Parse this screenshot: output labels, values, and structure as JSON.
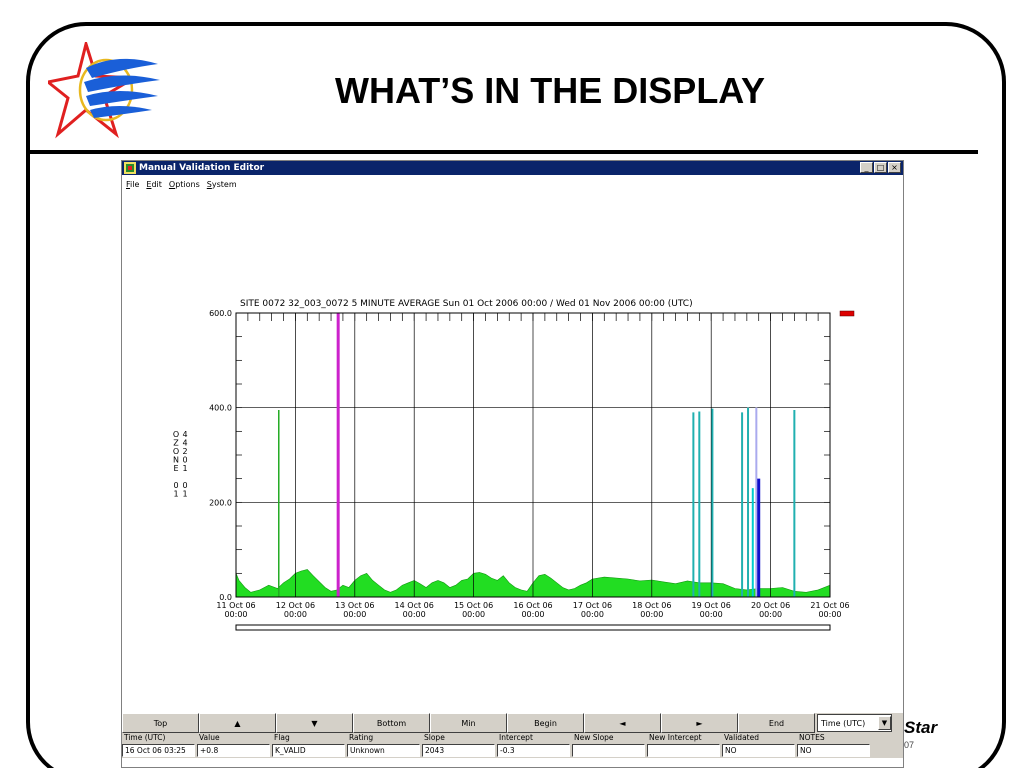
{
  "slide": {
    "title": "WHAT’S IN THE DISPLAY",
    "footer_text": "Star",
    "footer_number": "07"
  },
  "window": {
    "title": "Manual Validation Editor",
    "menu": [
      "File",
      "Edit",
      "Options",
      "System"
    ],
    "controls": [
      "minimize-icon",
      "maximize-icon",
      "close-icon"
    ]
  },
  "chart_data": {
    "type": "area",
    "title": "SITE 0072 32_003_0072 5 MINUTE AVERAGE Sun 01 Oct 2006 00:00 / Wed 01 Nov 2006 00:00 (UTC)",
    "ylabel_chars": [
      "O",
      "Z",
      "O",
      "N",
      "E",
      "",
      "0",
      "1"
    ],
    "ylabel_code": [
      "4",
      "4",
      "2",
      "0",
      "1",
      "",
      "0",
      "1"
    ],
    "ylim": [
      0,
      600
    ],
    "yticks": [
      {
        "value": 0,
        "label": "0.0"
      },
      {
        "value": 200,
        "label": "200.0"
      },
      {
        "value": 400,
        "label": "400.0"
      },
      {
        "value": 600,
        "label": "600.0"
      }
    ],
    "xlim": [
      "2006-10-11 00:00",
      "2006-10-21 00:00"
    ],
    "xticks": [
      {
        "day": 0,
        "date": "11 Oct 06",
        "time": "00:00"
      },
      {
        "day": 1,
        "date": "12 Oct 06",
        "time": "00:00"
      },
      {
        "day": 2,
        "date": "13 Oct 06",
        "time": "00:00"
      },
      {
        "day": 3,
        "date": "14 Oct 06",
        "time": "00:00"
      },
      {
        "day": 4,
        "date": "15 Oct 06",
        "time": "00:00"
      },
      {
        "day": 5,
        "date": "16 Oct 06",
        "time": "00:00"
      },
      {
        "day": 6,
        "date": "17 Oct 06",
        "time": "00:00"
      },
      {
        "day": 7,
        "date": "18 Oct 06",
        "time": "00:00"
      },
      {
        "day": 8,
        "date": "19 Oct 06",
        "time": "00:00"
      },
      {
        "day": 9,
        "date": "20 Oct 06",
        "time": "00:00"
      },
      {
        "day": 10,
        "date": "21 Oct 06",
        "time": "00:00"
      }
    ],
    "grid": true,
    "series": [
      {
        "color": "#22dd22",
        "x": [
          0,
          0.05,
          0.15,
          0.25,
          0.4,
          0.55,
          0.7,
          0.8,
          0.9,
          1.0,
          1.1,
          1.2,
          1.3,
          1.5,
          1.6,
          1.7,
          1.8,
          1.9,
          2.0,
          2.1,
          2.2,
          2.3,
          2.4,
          2.5,
          2.6,
          2.7,
          2.8,
          2.9,
          3.0,
          3.1,
          3.2,
          3.3,
          3.4,
          3.5,
          3.6,
          3.7,
          3.8,
          3.9,
          4.0,
          4.1,
          4.2,
          4.3,
          4.4,
          4.5,
          4.6,
          4.7,
          4.8,
          4.9,
          5.0,
          5.1,
          5.2,
          5.3,
          5.4,
          5.5,
          5.6,
          5.7,
          5.8,
          5.9,
          6.0,
          6.2,
          6.4,
          6.6,
          6.8,
          7.0,
          7.2,
          7.4,
          7.6,
          7.8,
          8.0,
          8.2,
          8.4,
          8.6,
          8.8,
          9.0,
          9.2,
          9.4,
          9.6,
          9.8,
          10.0
        ],
        "y": [
          50,
          35,
          20,
          10,
          15,
          25,
          18,
          30,
          38,
          50,
          55,
          58,
          45,
          20,
          12,
          15,
          25,
          20,
          35,
          45,
          50,
          35,
          25,
          15,
          10,
          15,
          25,
          30,
          35,
          28,
          20,
          30,
          35,
          30,
          20,
          25,
          35,
          38,
          50,
          52,
          48,
          40,
          35,
          45,
          30,
          20,
          15,
          12,
          30,
          45,
          48,
          40,
          30,
          20,
          15,
          18,
          25,
          30,
          38,
          42,
          40,
          38,
          34,
          36,
          32,
          28,
          34,
          30,
          30,
          28,
          18,
          15,
          18,
          18,
          20,
          12,
          10,
          15,
          25
        ]
      }
    ],
    "spikes": [
      {
        "x": 0.72,
        "y": 395,
        "color": "#22aa22",
        "width": 1.5
      },
      {
        "x": 1.72,
        "y": 600,
        "color": "#cc22cc",
        "width": 3
      },
      {
        "x": 7.7,
        "y": 390,
        "color": "#20b0b0",
        "width": 2
      },
      {
        "x": 7.8,
        "y": 392,
        "color": "#20b0b0",
        "width": 2
      },
      {
        "x": 8.02,
        "y": 398,
        "color": "#20b0b0",
        "width": 2
      },
      {
        "x": 8.52,
        "y": 390,
        "color": "#20b0b0",
        "width": 2
      },
      {
        "x": 8.62,
        "y": 400,
        "color": "#20b0b0",
        "width": 2
      },
      {
        "x": 8.7,
        "y": 230,
        "color": "#00cccc",
        "width": 2
      },
      {
        "x": 8.76,
        "y": 400,
        "color": "#aaaaee",
        "width": 2
      },
      {
        "x": 8.8,
        "y": 250,
        "color": "#1010cc",
        "width": 3
      },
      {
        "x": 9.4,
        "y": 395,
        "color": "#20b0b0",
        "width": 2
      }
    ],
    "legend_color": "#dd0000"
  },
  "toolbar": {
    "buttons": [
      {
        "name": "top-button",
        "label": "Top"
      },
      {
        "name": "up-arrow-button",
        "label": "▲"
      },
      {
        "name": "down-arrow-button",
        "label": "▼"
      },
      {
        "name": "bottom-button",
        "label": "Bottom"
      },
      {
        "name": "min-button",
        "label": "Min"
      },
      {
        "name": "begin-button",
        "label": "Begin"
      },
      {
        "name": "left-arrow-button",
        "label": "◄"
      },
      {
        "name": "right-arrow-button",
        "label": "►"
      },
      {
        "name": "end-button",
        "label": "End"
      }
    ],
    "select_value": "Time (UTC)"
  },
  "grid": {
    "headers": [
      "Time (UTC)",
      "Value",
      "Flag",
      "Rating",
      "Slope",
      "Intercept",
      "New Slope",
      "New Intercept",
      "Validated",
      "NOTES"
    ],
    "row": [
      "16 Oct 06 03:25",
      "+0.8",
      "K_VALID",
      "Unknown",
      "2043",
      "-0.3",
      "",
      "",
      "NO",
      "NO"
    ]
  }
}
